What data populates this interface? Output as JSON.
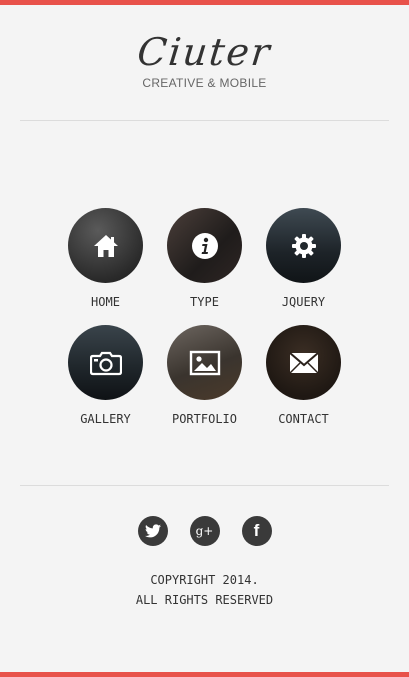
{
  "app": {
    "logo_text": "Ciuter",
    "tagline": "CREATIVE & MOBILE",
    "accent_color": "#e8524a"
  },
  "menu": {
    "rows": [
      [
        {
          "label": "HOME",
          "icon": "house-icon"
        },
        {
          "label": "TYPE",
          "icon": "info-icon"
        },
        {
          "label": "JQUERY",
          "icon": "gear-icon"
        }
      ],
      [
        {
          "label": "GALLERY",
          "icon": "camera-icon"
        },
        {
          "label": "PORTFOLIO",
          "icon": "image-icon"
        },
        {
          "label": "CONTACT",
          "icon": "envelope-icon"
        }
      ]
    ]
  },
  "social": {
    "twitter_icon": "twitter-icon",
    "googleplus_glyph": "g+",
    "facebook_glyph": "f"
  },
  "footer": {
    "copyright_line1": "COPYRIGHT 2014.",
    "copyright_line2": "ALL RIGHTS RESERVED"
  }
}
